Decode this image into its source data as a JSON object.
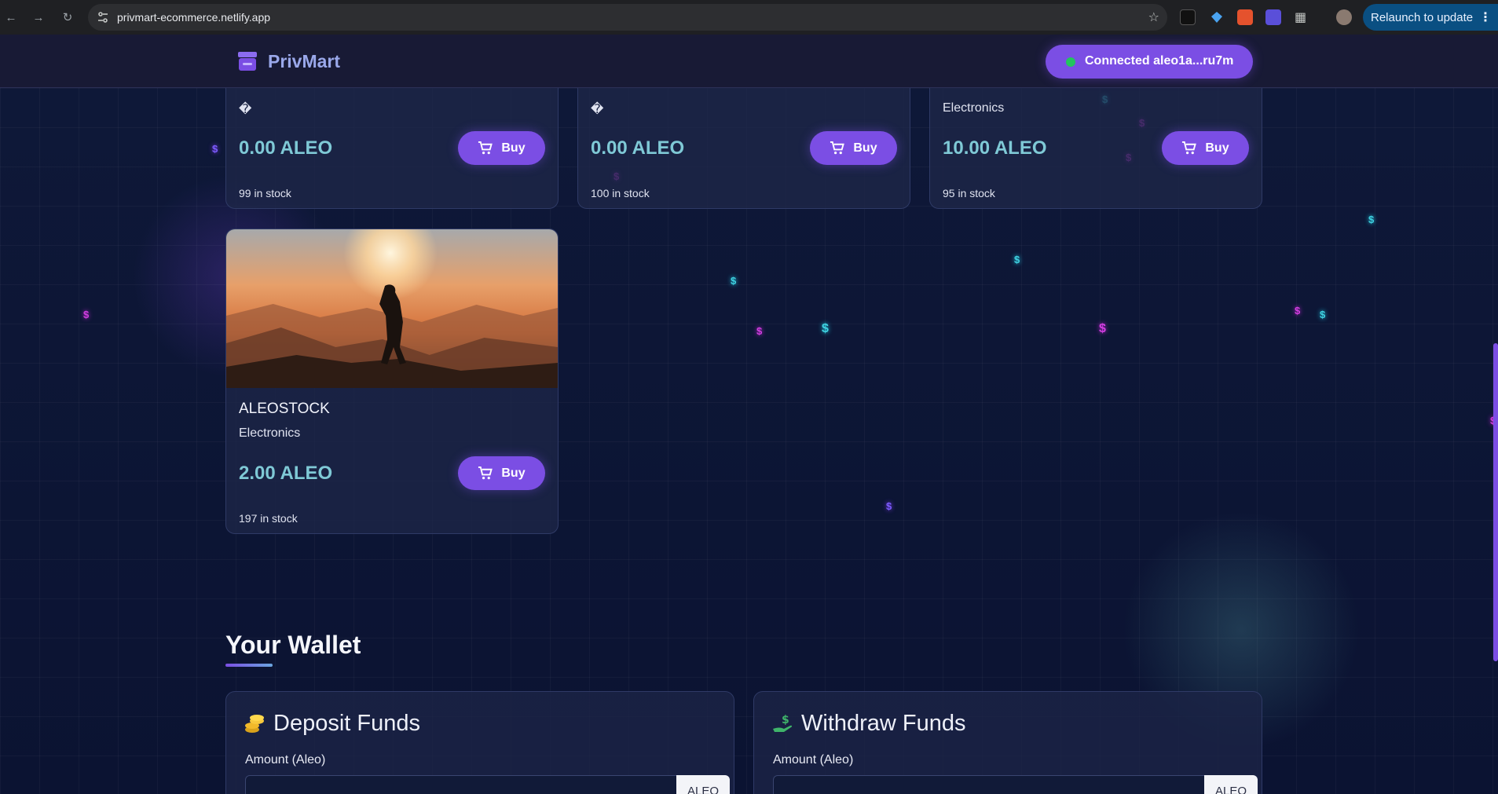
{
  "browser": {
    "url": "privmart-ecommerce.netlify.app",
    "relaunch_label": "Relaunch to update"
  },
  "header": {
    "brand": "PrivMart",
    "connect_label": "Connected aleo1a...ru7m",
    "status_color": "#22c55e"
  },
  "products": [
    {
      "category": "�",
      "price": "0.00 ALEO",
      "stock": "99 in stock",
      "buy_label": "Buy"
    },
    {
      "category": "�",
      "price": "0.00 ALEO",
      "stock": "100 in stock",
      "buy_label": "Buy"
    },
    {
      "category": "Electronics",
      "price": "10.00 ALEO",
      "stock": "95 in stock",
      "buy_label": "Buy"
    },
    {
      "name": "ALEOSTOCK",
      "category": "Electronics",
      "price": "2.00 ALEO",
      "stock": "197 in stock",
      "buy_label": "Buy"
    }
  ],
  "wallet": {
    "title": "Your Wallet",
    "deposit": {
      "title": "Deposit Funds",
      "field_label": "Amount (Aleo)",
      "unit": "ALEO"
    },
    "withdraw": {
      "title": "Withdraw Funds",
      "field_label": "Amount (Aleo)",
      "unit": "ALEO"
    }
  },
  "theme": {
    "accent": "#7b4ee4",
    "price_color": "#7fc9d6",
    "background": "#0c1430"
  }
}
